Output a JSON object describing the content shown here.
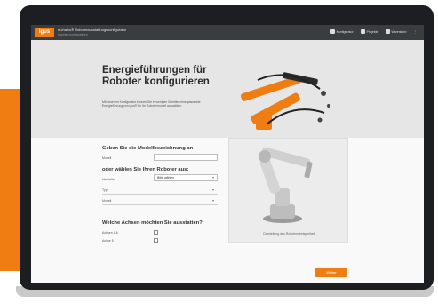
{
  "topbar": {
    "logo": "igus",
    "title": "e-chains® Roboterausstattungskonfigurator",
    "subtitle": "Machen konfigurieren",
    "nav": [
      {
        "icon": "wrench-icon",
        "label": "Konfigurator"
      },
      {
        "icon": "folder-icon",
        "label": "Projekte"
      },
      {
        "icon": "cart-icon",
        "label": "Warenkorb"
      }
    ]
  },
  "hero": {
    "title": "Energieführungen für Roboter konfigurieren",
    "text": "Mit unserem Konfigurator können Sie in wenigen Schritten eine passende Energieführung von igus® für Ihr Robotermodell auswählen."
  },
  "form": {
    "model_heading": "Geben Sie die Modellbezeichnung an",
    "model_label": "Modell",
    "model_value": "",
    "robot_heading": "oder wählen Sie Ihren Roboter aus:",
    "manufacturer_label": "Hersteller",
    "manufacturer_value": "Bitte wählen",
    "type_label": "Typ",
    "type_value": "",
    "model2_label": "Modell",
    "model2_value": "",
    "axes_heading": "Welche Achsen möchten Sie ausstatten?",
    "axes": [
      {
        "label": "Achsen 1-6",
        "checked": false
      },
      {
        "label": "Achse 5",
        "checked": false
      }
    ],
    "submit": "Weiter"
  },
  "preview": {
    "caption": "Darstellung des Roboters beispielhaft"
  },
  "colors": {
    "accent": "#ef7d12",
    "topbar": "#3a3d40",
    "hero_bg": "#e6e6e6"
  }
}
